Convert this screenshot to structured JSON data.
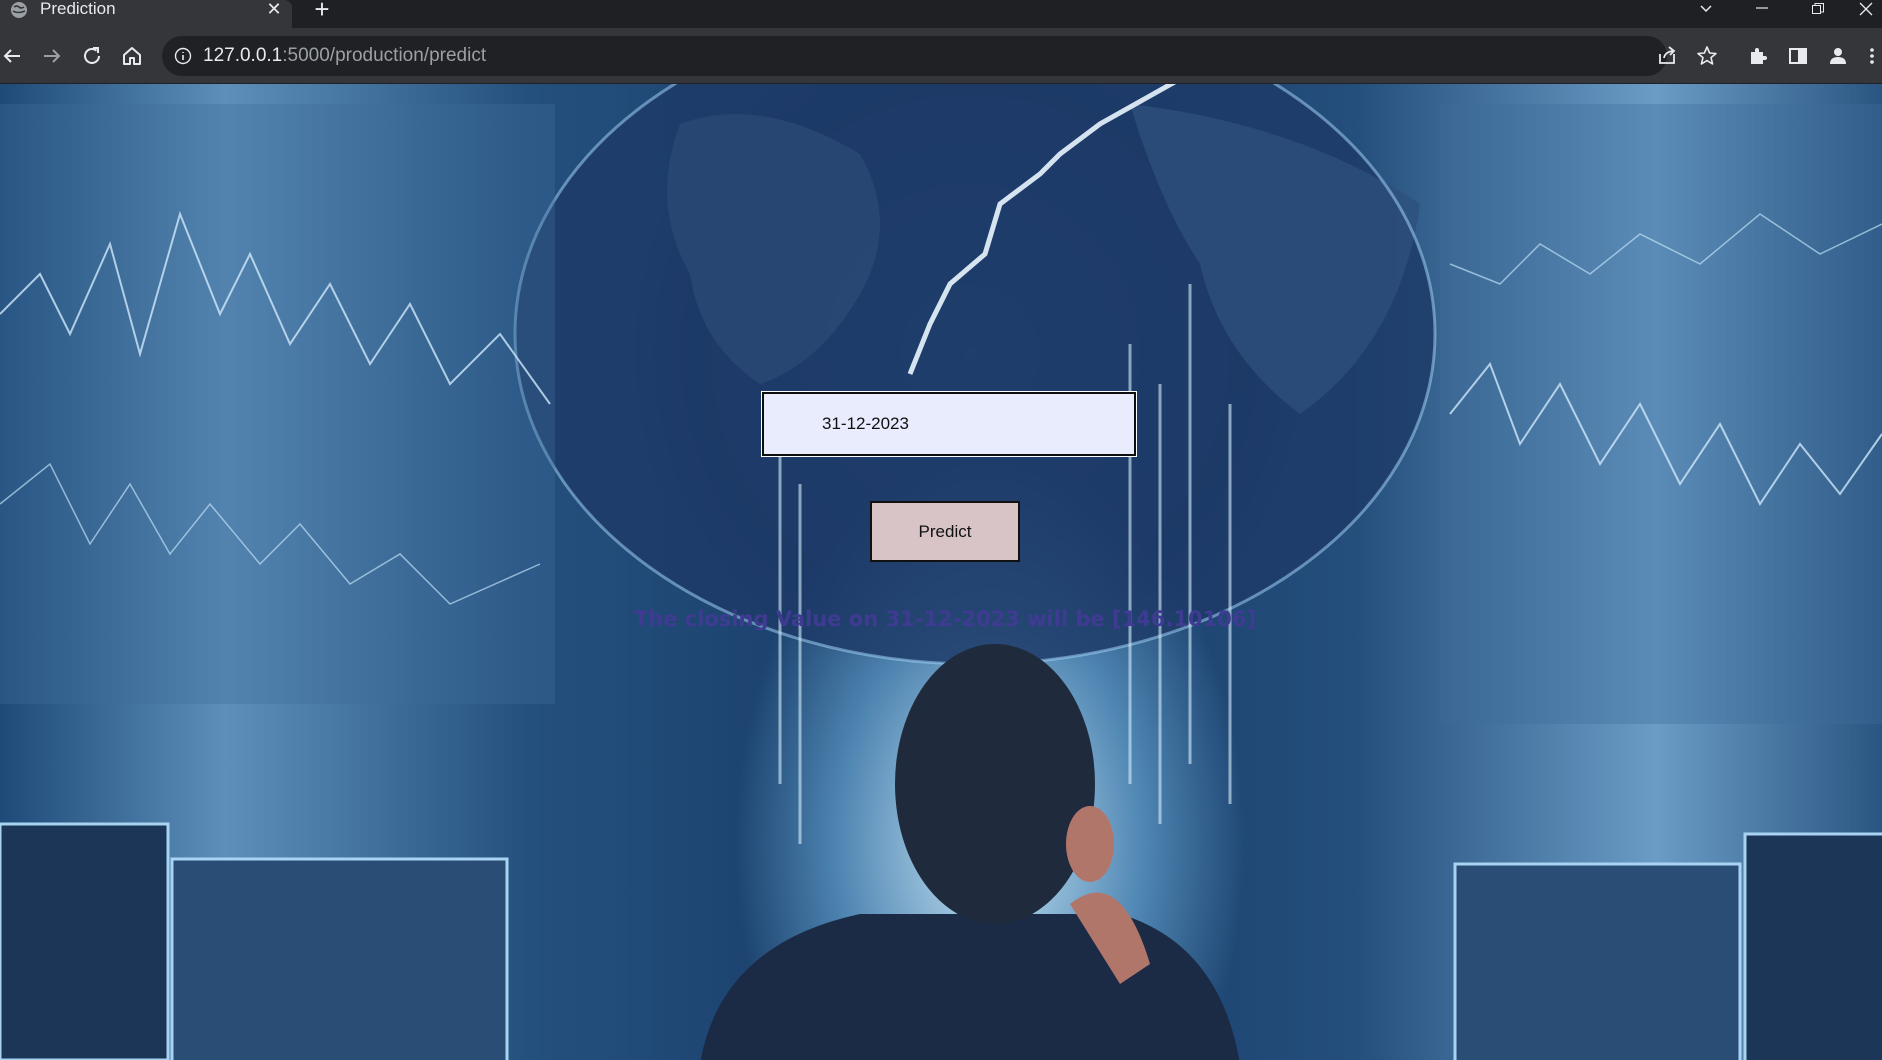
{
  "browser": {
    "tab_title": "Prediction",
    "url_host": "127.0.0.1",
    "url_path": ":5000/production/predict",
    "icons": {
      "favicon": "globe-icon",
      "tab_close": "close-icon",
      "new_tab": "plus-icon",
      "back": "back-arrow-icon",
      "forward": "forward-arrow-icon",
      "reload": "reload-icon",
      "home": "home-icon",
      "site_info": "info-icon",
      "share": "share-icon",
      "bookmark": "star-icon",
      "extensions": "puzzle-icon",
      "side_panel": "side-panel-icon",
      "profile": "profile-icon",
      "menu": "kebab-menu-icon"
    },
    "tab_close_glyph": "✕",
    "new_tab_glyph": "+"
  },
  "form": {
    "date_value": "31-12-2023",
    "predict_label": "Predict"
  },
  "result": {
    "text": "The closing Value on 31-12-2023 will be [146.10106]"
  },
  "colors": {
    "result_text": "#3f3b92",
    "button_bg": "#d8c3c6",
    "input_bg": "#e8ecfc"
  }
}
